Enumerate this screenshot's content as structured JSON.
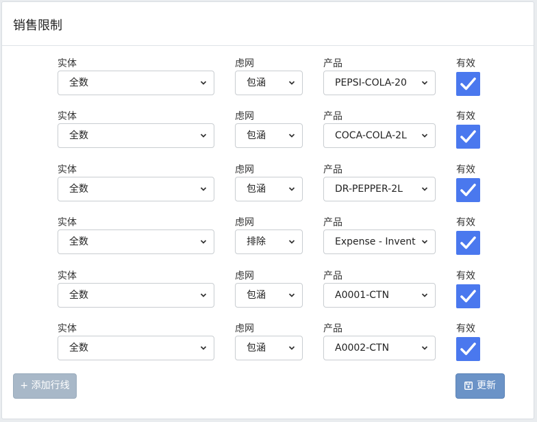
{
  "card": {
    "title": "销售限制"
  },
  "labels": {
    "entity": "实体",
    "filter": "虑网",
    "product": "产品",
    "valid": "有效"
  },
  "rows": [
    {
      "entity": "全数",
      "filter": "包涵",
      "product": "PEPSI-COLA-20",
      "valid": true
    },
    {
      "entity": "全数",
      "filter": "包涵",
      "product": "COCA-COLA-2L",
      "valid": true
    },
    {
      "entity": "全数",
      "filter": "包涵",
      "product": "DR-PEPPER-2L",
      "valid": true
    },
    {
      "entity": "全数",
      "filter": "排除",
      "product": "Expense - Inventory",
      "valid": true
    },
    {
      "entity": "全数",
      "filter": "包涵",
      "product": "A0001-CTN",
      "valid": true
    },
    {
      "entity": "全数",
      "filter": "包涵",
      "product": "A0002-CTN",
      "valid": true
    }
  ],
  "buttons": {
    "add_row": "+ 添加行线",
    "update": "更新"
  },
  "icons": {
    "select": "chevron-down-icon",
    "checkbox": "checkmark-icon",
    "update": "save-icon"
  },
  "colors": {
    "checkbox": "#4a78ee",
    "update_button": "#6b93c7",
    "add_button": "#a8b8c8"
  }
}
